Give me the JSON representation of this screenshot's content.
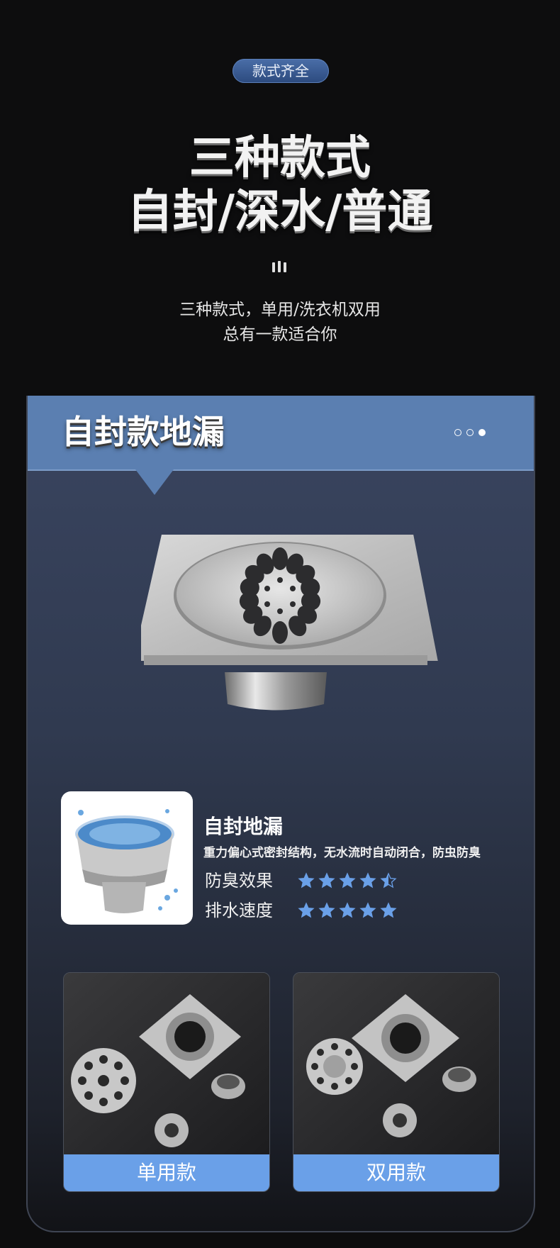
{
  "header": {
    "pill_label": "款式齐全",
    "title_line1": "三种款式",
    "title_line2": "自封/深水/普通",
    "subtitle_line1": "三种款式，单用/洗衣机双用",
    "subtitle_line2": "总有一款适合你"
  },
  "card": {
    "title": "自封款地漏",
    "page_dots": 3,
    "active_dot": 3
  },
  "feature": {
    "name": "自封地漏",
    "description": "重力偏心式密封结构，无水流时自动闭合，防虫防臭",
    "ratings": [
      {
        "label": "防臭效果",
        "stars": 4.5,
        "max": 5
      },
      {
        "label": "排水速度",
        "stars": 5,
        "max": 5
      }
    ]
  },
  "variants": [
    {
      "label": "单用款"
    },
    {
      "label": "双用款"
    }
  ],
  "colors": {
    "accent_blue": "#5b7fb1",
    "star_blue": "#6aa0e8",
    "background": "#0d0d0e"
  }
}
